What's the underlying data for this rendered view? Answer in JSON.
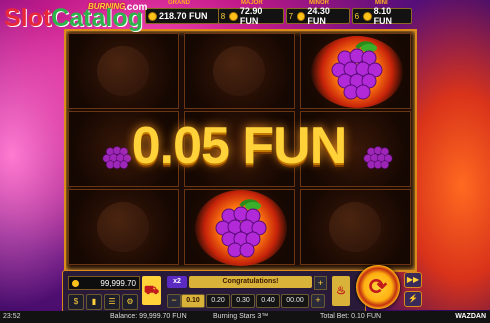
{
  "watermark": {
    "slot": "Slot",
    "catalog": "Catalog",
    "com": ".com"
  },
  "game_logo": "BURNING",
  "jackpots": [
    {
      "label": "GRAND",
      "num": "",
      "value": "218.70 FUN"
    },
    {
      "label": "MAJOR",
      "num": "8",
      "value": "72.90 FUN"
    },
    {
      "label": "MINOR",
      "num": "7",
      "value": "24.30 FUN"
    },
    {
      "label": "MINI",
      "num": "6",
      "value": "8.10 FUN"
    }
  ],
  "win": "0.05 FUN",
  "panel": {
    "balance_box": "99,999.70",
    "multiplier": "x2",
    "message": "Congratulations!",
    "bets": [
      "0.10",
      "0.20",
      "0.30",
      "0.40",
      "00.00"
    ],
    "minus": "−",
    "plus": "+"
  },
  "status": {
    "time": "23:52",
    "balance": "Balance: 99,999.70 FUN",
    "game": "Burning Stars 3™",
    "total_bet": "Total Bet: 0.10 FUN",
    "brand": "WAZDAN"
  },
  "colors": {
    "gold": "#ffd23a",
    "frame": "#d98a1a"
  }
}
